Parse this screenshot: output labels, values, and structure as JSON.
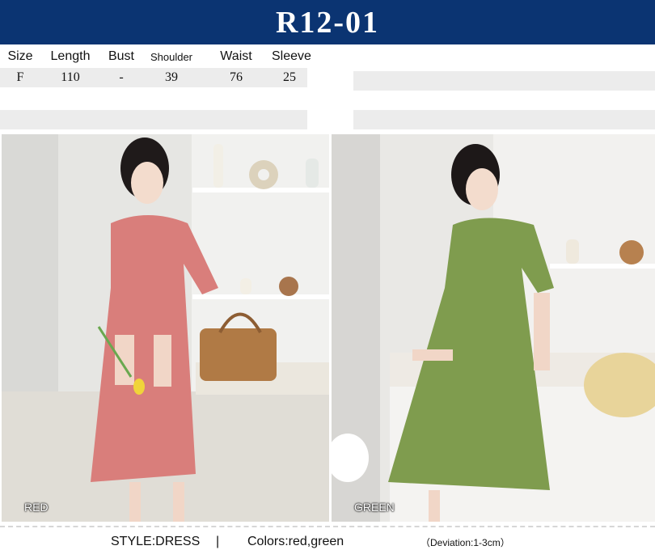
{
  "banner": {
    "title": "R12-01"
  },
  "size_table": {
    "headers": [
      "Size",
      "Length",
      "Bust",
      "Shoulder",
      "Waist",
      "Sleeve"
    ],
    "row": [
      "F",
      "110",
      "-",
      "39",
      "76",
      "25"
    ]
  },
  "photos": {
    "left_label": "RED",
    "right_label": "GREEN"
  },
  "footer": {
    "style": "STYLE:DRESS",
    "separator": "|",
    "colors": "Colors:red,green",
    "deviation": "（Deviation:1-3cm）"
  },
  "palette": {
    "banner": "#0b3472",
    "red_dress": "#d97e7b",
    "green_dress": "#7f9c4e"
  }
}
